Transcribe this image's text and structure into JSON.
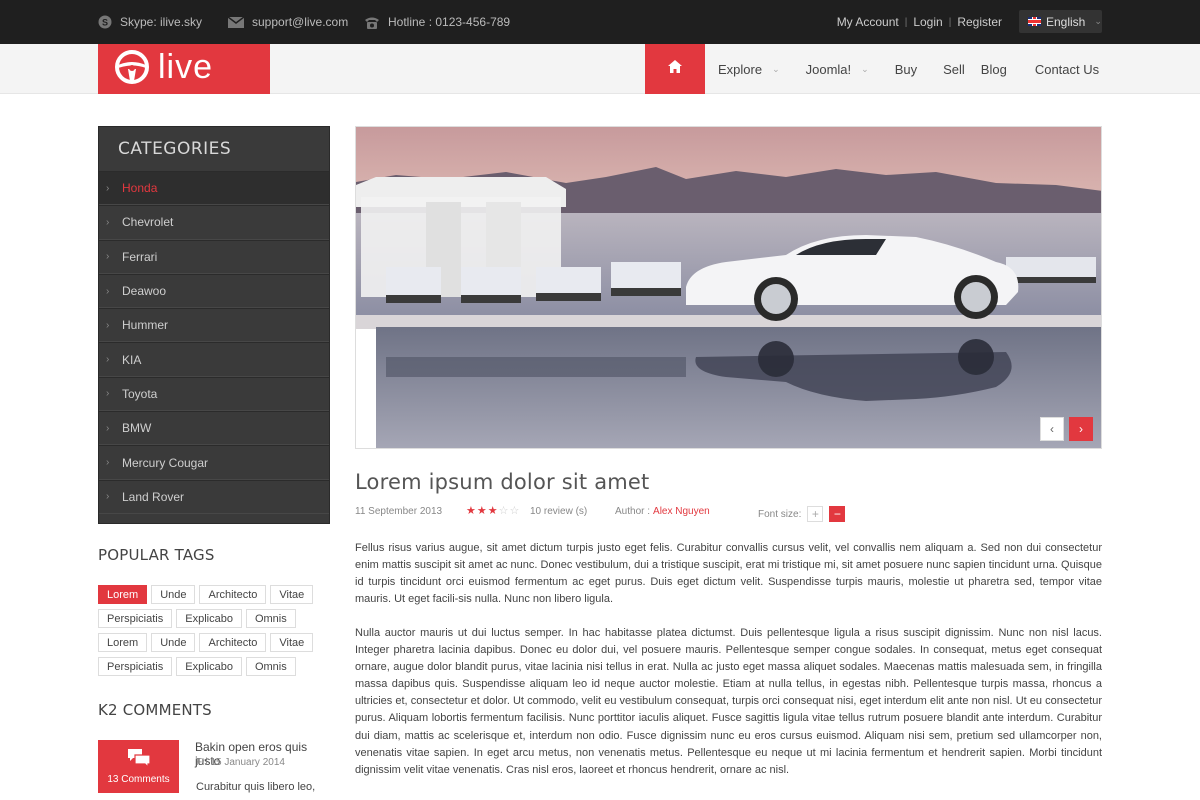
{
  "topbar": {
    "skype": "Skype: ilive.sky",
    "email": "support@live.com",
    "hotline": "Hotline : 0123-456-789",
    "my_account": "My Account",
    "login": "Login",
    "register": "Register",
    "language": "English"
  },
  "header": {
    "logo_text": "live",
    "nav": [
      "Explore",
      "Joomla!",
      "Buy",
      "Sell",
      "Blog",
      "Contact Us"
    ]
  },
  "sidebar": {
    "categories_title": "CATEGORIES",
    "categories": [
      "Honda",
      "Chevrolet",
      "Ferrari",
      "Deawoo",
      "Hummer",
      "KIA",
      "Toyota",
      "BMW",
      "Mercury Cougar",
      "Land Rover"
    ],
    "tags_title": "POPULAR TAGS",
    "tags": [
      "Lorem",
      "Unde",
      "Architecto",
      "Vitae",
      "Perspiciatis",
      "Explicabo",
      "Omnis",
      "Lorem",
      "Unde",
      "Architecto",
      "Vitae",
      "Perspiciatis",
      "Explicabo",
      "Omnis"
    ],
    "comments_title": "K2 COMMENTS",
    "comment": {
      "count": "13 Comments",
      "title": "Bakin open eros quis justo",
      "date": "Fri 15 January 2014",
      "text": "Curabitur quis libero leo,"
    }
  },
  "article": {
    "title": "Lorem ipsum dolor sit amet",
    "date": "11 September 2013",
    "rating": 3,
    "rating_max": 5,
    "reviews": "10 review (s)",
    "author_label": "Author :",
    "author_name": "Alex Nguyen",
    "font_size_label": "Font size:",
    "paragraph1": "Fellus risus varius augue, sit amet dictum turpis justo eget felis. Curabitur convallis cursus velit, vel convallis nem aliquam a. Sed non dui consectetur enim mattis suscipit sit amet ac nunc. Donec vestibulum, dui a tristique suscipit, erat mi tristique mi, sit amet posuere nunc sapien tincidunt urna. Quisque id turpis tincidunt orci euismod fermentum ac eget purus. Duis eget dictum velit. Suspendisse turpis mauris, molestie ut pharetra sed, tempor vitae mauris. Ut eget facili-sis nulla. Nunc non libero ligula.",
    "paragraph2": "Nulla auctor mauris ut dui luctus semper. In hac habitasse platea dictumst. Duis pellentesque ligula a risus suscipit dignissim. Nunc non nisl lacus. Integer pharetra lacinia dapibus. Donec eu dolor dui, vel posuere mauris. Pellentesque semper congue sodales. In consequat, metus eget consequat ornare, augue dolor blandit purus, vitae lacinia nisi tellus in erat. Nulla ac justo eget massa aliquet sodales. Maecenas mattis malesuada sem, in fringilla massa dapibus quis. Suspendisse aliquam leo id neque auctor molestie. Etiam at nulla tellus, in egestas nibh. Pellentesque turpis massa, rhoncus a ultricies et, consectetur et dolor. Ut commodo, velit eu vestibulum consequat, turpis orci consequat nisi, eget interdum elit ante non nisl. Ut eu consectetur purus. Aliquam lobortis fermentum facilisis. Nunc porttitor iaculis aliquet. Fusce sagittis ligula vitae tellus rutrum posuere blandit ante interdum. Curabitur dui diam, mattis ac scelerisque et, interdum non odio. Fusce dignissim nunc eu eros cursus euismod. Aliquam nisi sem, pretium sed ullamcorper non, venenatis vitae sapien. In eget arcu metus, non venenatis metus. Pellentesque eu neque ut mi lacinia fermentum et hendrerit sapien. Morbi tincidunt dignissim velit vitae venenatis. Cras nisl eros, laoreet et rhoncus hendrerit, ornare ac nisl."
  },
  "colors": {
    "accent": "#e2383f",
    "topbar": "#1f1f1f",
    "sidebar": "#3a3a3a"
  }
}
